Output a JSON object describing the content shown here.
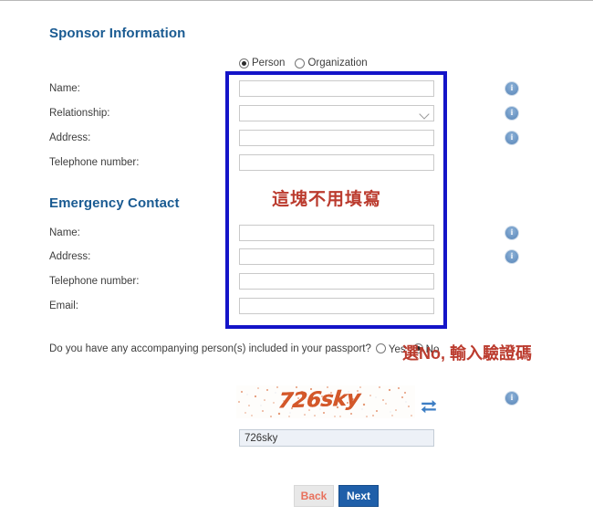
{
  "sponsor": {
    "heading": "Sponsor Information",
    "type_options": [
      {
        "label": "Person",
        "checked": true
      },
      {
        "label": "Organization",
        "checked": false
      }
    ],
    "fields": [
      {
        "label": "Name:",
        "value": "",
        "control": "text",
        "info": true
      },
      {
        "label": "Relationship:",
        "value": "",
        "control": "select",
        "info": true
      },
      {
        "label": "Address:",
        "value": "",
        "control": "text",
        "info": true
      },
      {
        "label": "Telephone number:",
        "value": "",
        "control": "text",
        "info": false
      }
    ]
  },
  "emergency": {
    "heading": "Emergency Contact",
    "fields": [
      {
        "label": "Name:",
        "value": "",
        "control": "text",
        "info": true
      },
      {
        "label": "Address:",
        "value": "",
        "control": "text",
        "info": true
      },
      {
        "label": "Telephone number:",
        "value": "",
        "control": "text",
        "info": false
      },
      {
        "label": "Email:",
        "value": "",
        "control": "text",
        "info": false
      }
    ]
  },
  "accompanying": {
    "question": "Do you have any accompanying person(s) included in your passport?",
    "options": [
      {
        "label": "Yes",
        "checked": false
      },
      {
        "label": "No",
        "checked": true
      }
    ]
  },
  "captcha": {
    "image_text": "726sky",
    "input_value": "726sky",
    "refresh_icon": "refresh-icon",
    "info_icon": "info-icon"
  },
  "buttons": {
    "back": "Back",
    "next": "Next"
  },
  "annotations": {
    "skip_section": "這塊不用填寫",
    "captcha_hint": "選No, 輸入驗證碼",
    "box_color": "#1414c8",
    "text_color": "#bb3b2e"
  },
  "icons": {
    "info": "i"
  },
  "colors": {
    "heading": "#1a5b92",
    "next_button": "#1f5fa9",
    "back_button_text": "#e8705c",
    "captcha_text": "#d4582a"
  }
}
